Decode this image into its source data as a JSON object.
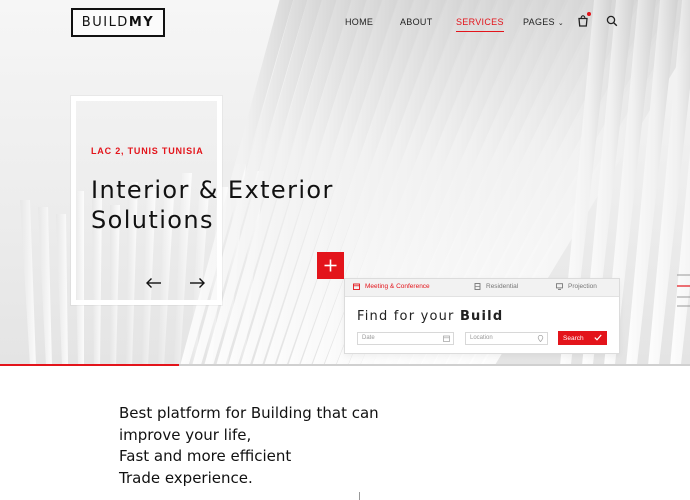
{
  "brand": {
    "logo_part1": "BUILD",
    "logo_part2": "MY"
  },
  "nav": {
    "items": [
      {
        "label": "HOME"
      },
      {
        "label": "ABOUT"
      },
      {
        "label": "SERVICES",
        "active": true
      },
      {
        "label": "PAGES"
      }
    ],
    "icons": [
      "cart-icon",
      "search-icon"
    ]
  },
  "hero": {
    "kicker": "LAC 2, TUNIS TUNISIA",
    "headline_line1": "Interior & Exterior",
    "headline_line2": "Solutions",
    "slider_progress": 0.26
  },
  "search_panel": {
    "tabs": [
      {
        "label": "Meeting & Conference",
        "icon": "calendar-icon",
        "active": true
      },
      {
        "label": "Residential",
        "icon": "building-icon"
      },
      {
        "label": "Projection",
        "icon": "monitor-icon"
      }
    ],
    "title_prefix": "Find for your ",
    "title_highlight": "Build",
    "date_placeholder": "Date",
    "location_placeholder": "Location",
    "search_label": "Search"
  },
  "intro": {
    "lines": [
      "Best platform for Building that can",
      "improve your life,",
      "Fast and more efficient",
      "Trade experience."
    ]
  },
  "colors": {
    "accent": "#e3141b",
    "text": "#111111"
  }
}
